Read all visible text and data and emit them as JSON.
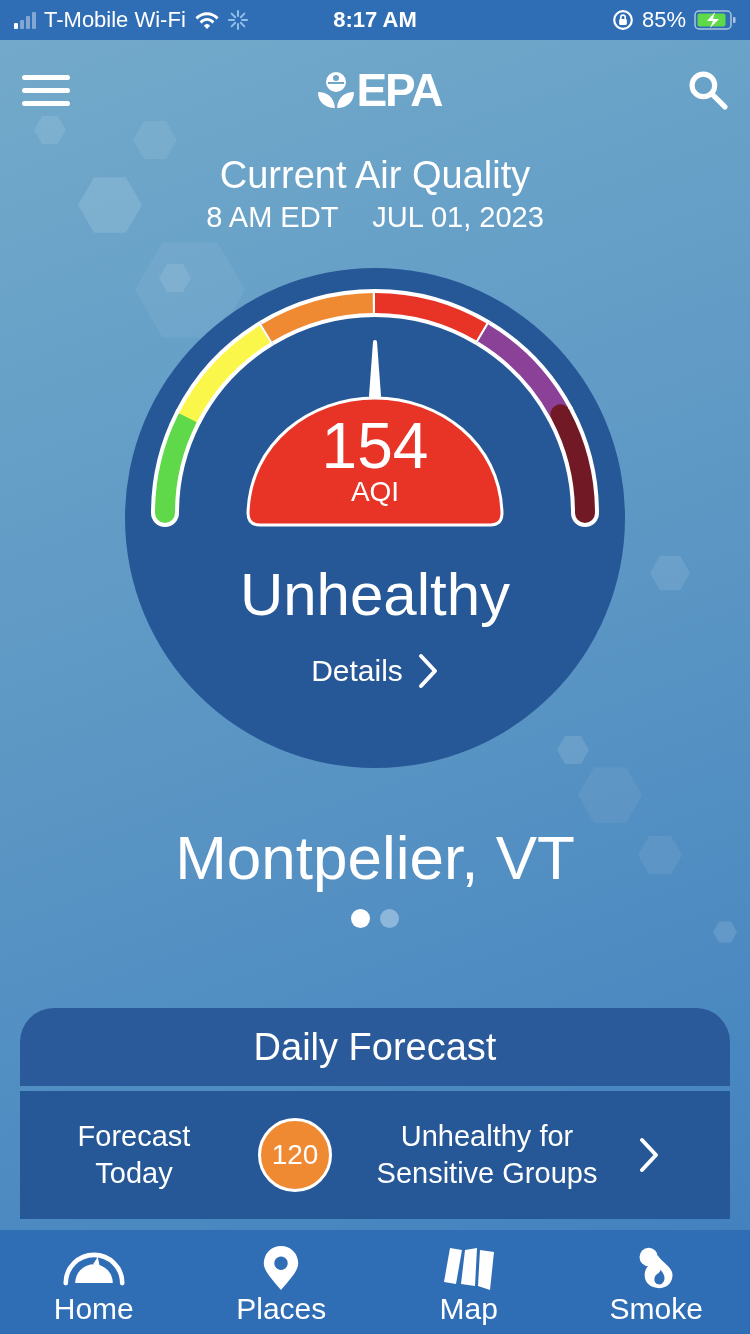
{
  "status_bar": {
    "carrier": "T-Mobile Wi-Fi",
    "time": "8:17 AM",
    "battery": "85%"
  },
  "header": {
    "logo": "EPA"
  },
  "air_quality": {
    "title": "Current Air Quality",
    "time": "8 AM EDT",
    "date": "JUL 01, 2023"
  },
  "gauge": {
    "segments": [
      {
        "color": "#5fd94a"
      },
      {
        "color": "#fbf74a"
      },
      {
        "color": "#ef8a33"
      },
      {
        "color": "#e73427"
      },
      {
        "color": "#8a4197"
      },
      {
        "color": "#711a25"
      }
    ],
    "value": "154",
    "unit": "AQI",
    "category": "Unhealthy",
    "details_link": "Details"
  },
  "location": "Montpelier, VT",
  "page_dots": [
    {
      "selected": true
    },
    {
      "selected": false
    }
  ],
  "forecast": {
    "title": "Daily Forecast",
    "label": "Forecast Today",
    "value": "120",
    "category": "Unhealthy for Sensitive Groups"
  },
  "tab_bar": [
    {
      "kind": "home",
      "label": "Home"
    },
    {
      "kind": "places",
      "label": "Places"
    },
    {
      "kind": "map",
      "label": "Map"
    },
    {
      "kind": "smoke",
      "label": "Smoke"
    }
  ]
}
